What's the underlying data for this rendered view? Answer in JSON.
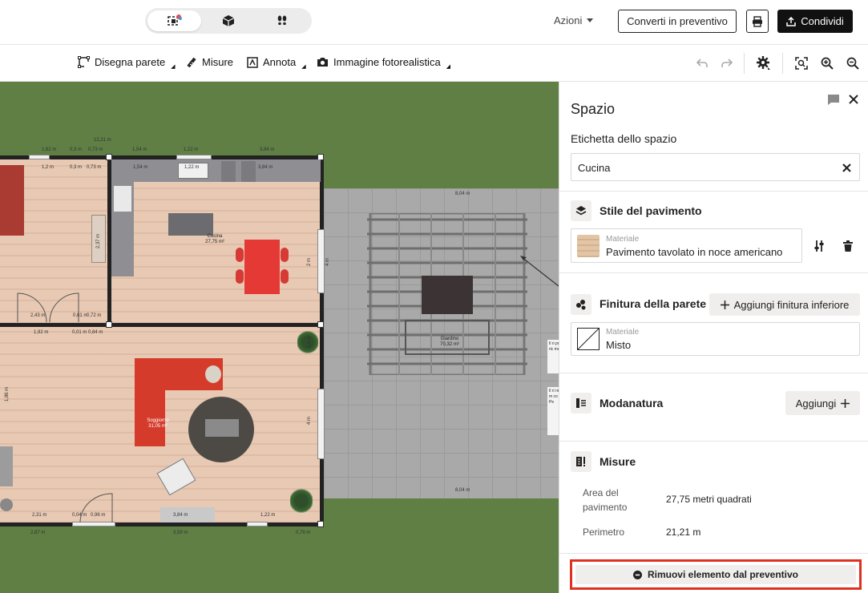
{
  "topbar": {
    "actions_label": "Azioni",
    "convert_label": "Converti in preventivo",
    "share_label": "Condividi"
  },
  "toolbar": {
    "draw_wall": "Disegna parete",
    "measures": "Misure",
    "annotate": "Annota",
    "photoreal": "Immagine fotorealistica"
  },
  "canvas": {
    "rooms": {
      "kitchen": {
        "name": "Cucina",
        "area": "27,75 m²"
      },
      "living": {
        "name": "Soggiorno",
        "area": "31,05 m²"
      },
      "garden": {
        "name": "Giardino",
        "area": "70,32 m²"
      }
    },
    "dims": {
      "d1": "1,62 m",
      "d2": "0,3 m",
      "d3": "0,73 m",
      "d4": "12,21 m",
      "d5": "1,54 m",
      "d6": "1,22 m",
      "d7": "3,84 m",
      "d8": "8,04 m",
      "d9": "2,43 m",
      "d10": "0,61 m",
      "d11": "0,72 m",
      "d12": "2,31 m",
      "d13": "1,92 m",
      "d14": "0,01 m",
      "d15": "0,84 m",
      "d16": "2,31 m",
      "d17": "0,04 m",
      "d18": "0,96 m",
      "d19": "3,84 m",
      "d20": "1,22 m",
      "d21": "2,87 m",
      "d22": "3,59 m",
      "d23": "0,79 m",
      "d24": "4 m",
      "d25": "2 m",
      "d26": "3,8 m",
      "d27": "4 m",
      "d28": "1,86 m",
      "d29": "2,37 m",
      "d30": "1,2 m"
    },
    "notes": [
      "Il ri pre ric me",
      "Il ri rie m co Pe"
    ]
  },
  "panel": {
    "title": "Spazio",
    "space_label_heading": "Etichetta dello spazio",
    "space_label_value": "Cucina",
    "floor_style_heading": "Stile del pavimento",
    "material_small": "Materiale",
    "floor_material": "Pavimento tavolato in noce americano",
    "wall_finish_heading": "Finitura della parete",
    "add_lower_finish": "Aggiungi finitura inferiore",
    "wall_material": "Misto",
    "molding_heading": "Modanatura",
    "add_label": "Aggiungi",
    "measures_heading": "Misure",
    "floor_area_label": "Area del pavimento",
    "floor_area_value": "27,75 metri quadrati",
    "perimeter_label": "Perimetro",
    "perimeter_value": "21,21 m",
    "remove_label": "Rimuovi elemento dal preventivo"
  },
  "icons": {
    "view_2d": "floorplan-2d-icon",
    "view_3d": "cube-3d-icon",
    "view_walk": "footsteps-icon",
    "print": "printer-icon",
    "share": "upload-icon",
    "undo": "undo-icon",
    "redo": "redo-icon",
    "settings": "gear-icon",
    "fit": "focus-frame-icon",
    "zoom_in": "zoom-in-icon",
    "zoom_out": "zoom-out-icon"
  },
  "colors": {
    "highlight": "#e03020",
    "grass": "#5f7f45",
    "floor": "#e8c9b4",
    "sofa": "#d53b2a"
  }
}
